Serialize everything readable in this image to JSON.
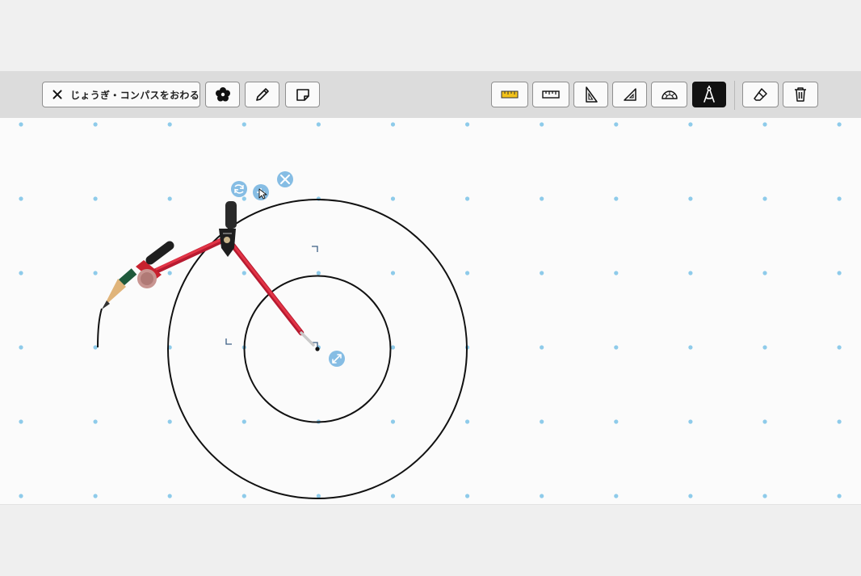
{
  "toolbar": {
    "exit_label": "じょうぎ・コンパスをおわる",
    "tools": [
      {
        "name": "stamp",
        "icon": "flower-icon"
      },
      {
        "name": "pen",
        "icon": "pencil-icon"
      },
      {
        "name": "sticky-note",
        "icon": "sticky-note-icon"
      },
      {
        "name": "ruler-yellow",
        "icon": "ruler-yellow-icon"
      },
      {
        "name": "ruler",
        "icon": "ruler-icon"
      },
      {
        "name": "set-square-30-60",
        "icon": "set-square-icon"
      },
      {
        "name": "set-square-45",
        "icon": "set-square-45-icon"
      },
      {
        "name": "protractor",
        "icon": "protractor-icon"
      },
      {
        "name": "compass",
        "icon": "compass-icon",
        "active": true
      },
      {
        "name": "eraser",
        "icon": "eraser-icon"
      },
      {
        "name": "trash",
        "icon": "trash-icon"
      }
    ]
  },
  "colors": {
    "grid_dot": "#8ecbea",
    "compass_red": "#d9283c",
    "handle_blue": "#7fb9e0",
    "active_tool": "#111111"
  }
}
